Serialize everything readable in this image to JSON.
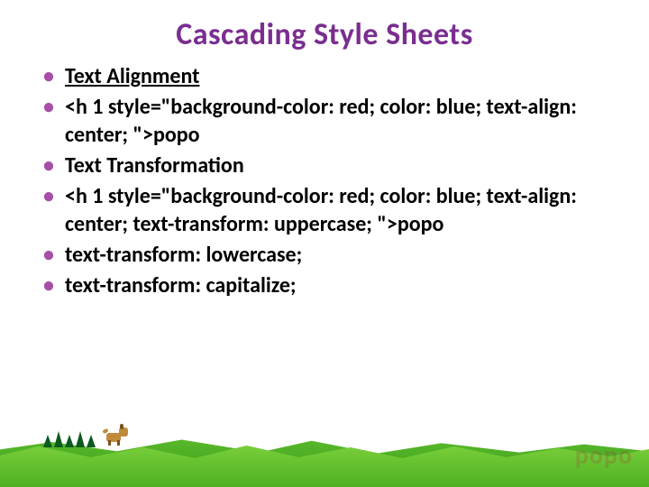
{
  "title": "Cascading Style Sheets",
  "bullets": [
    {
      "text": "Text Alignment",
      "underline": true
    },
    {
      "text": "<h 1 style=\"background-color: red; color: blue; text-align: center; \">popo",
      "underline": false
    },
    {
      "text": "Text Transformation",
      "underline": false
    },
    {
      "text": "<h 1 style=\"background-color: red; color: blue; text-align: center; text-transform: uppercase; \">popo",
      "underline": false
    },
    {
      "text": "text-transform: lowercase;",
      "underline": false
    },
    {
      "text": "text-transform: capitalize;",
      "underline": false
    }
  ],
  "watermark": "popo",
  "colors": {
    "title": "#7a2e8f",
    "bullet_marker": "#a64fa6",
    "grass_light": "#7dd13c",
    "grass_dark": "#3a9a1a",
    "tree": "#0c5a1e"
  }
}
